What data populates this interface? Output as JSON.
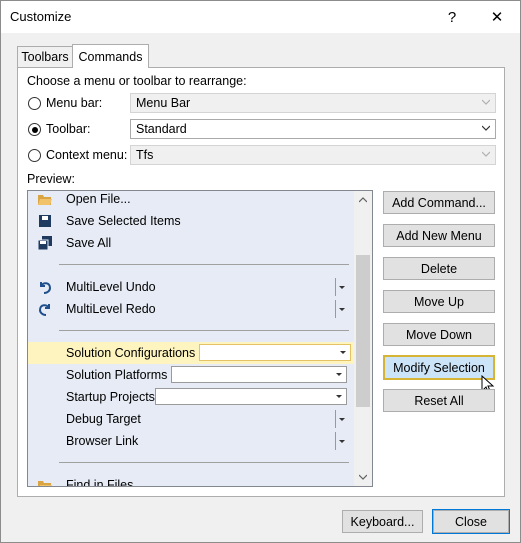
{
  "window": {
    "title": "Customize",
    "help_label": "?",
    "close_label": "✕"
  },
  "tabs": [
    {
      "label": "Toolbars"
    },
    {
      "label": "Commands"
    }
  ],
  "choose": {
    "heading": "Choose a menu or toolbar to rearrange:",
    "menu_bar": {
      "label": "Menu bar:",
      "value": "Menu Bar"
    },
    "toolbar": {
      "label": "Toolbar:",
      "value": "Standard"
    },
    "context_menu": {
      "label": "Context menu:",
      "value": "Tfs"
    }
  },
  "preview": {
    "label": "Preview:",
    "items": [
      {
        "label": "Open File...",
        "icon": "open-file-icon"
      },
      {
        "label": "Save Selected Items",
        "icon": "save-icon"
      },
      {
        "label": "Save All",
        "icon": "save-all-icon"
      },
      {
        "label": "MultiLevel Undo",
        "icon": "undo-icon"
      },
      {
        "label": "MultiLevel Redo",
        "icon": "redo-icon"
      },
      {
        "label": "Solution Configurations"
      },
      {
        "label": "Solution Platforms"
      },
      {
        "label": "Startup Projects"
      },
      {
        "label": "Debug Target"
      },
      {
        "label": "Browser Link"
      },
      {
        "label": "Find in Files",
        "icon": "find-in-files-icon"
      }
    ]
  },
  "buttons": {
    "add_command": "Add Command...",
    "add_new_menu": "Add New Menu",
    "delete": "Delete",
    "move_up": "Move Up",
    "move_down": "Move Down",
    "modify_selection": "Modify Selection",
    "reset_all": "Reset All",
    "keyboard": "Keyboard...",
    "close": "Close"
  },
  "colors": {
    "highlight": "#fef4bf",
    "preview_bg": "#e6ebf5",
    "focus_border": "#0078d7"
  }
}
